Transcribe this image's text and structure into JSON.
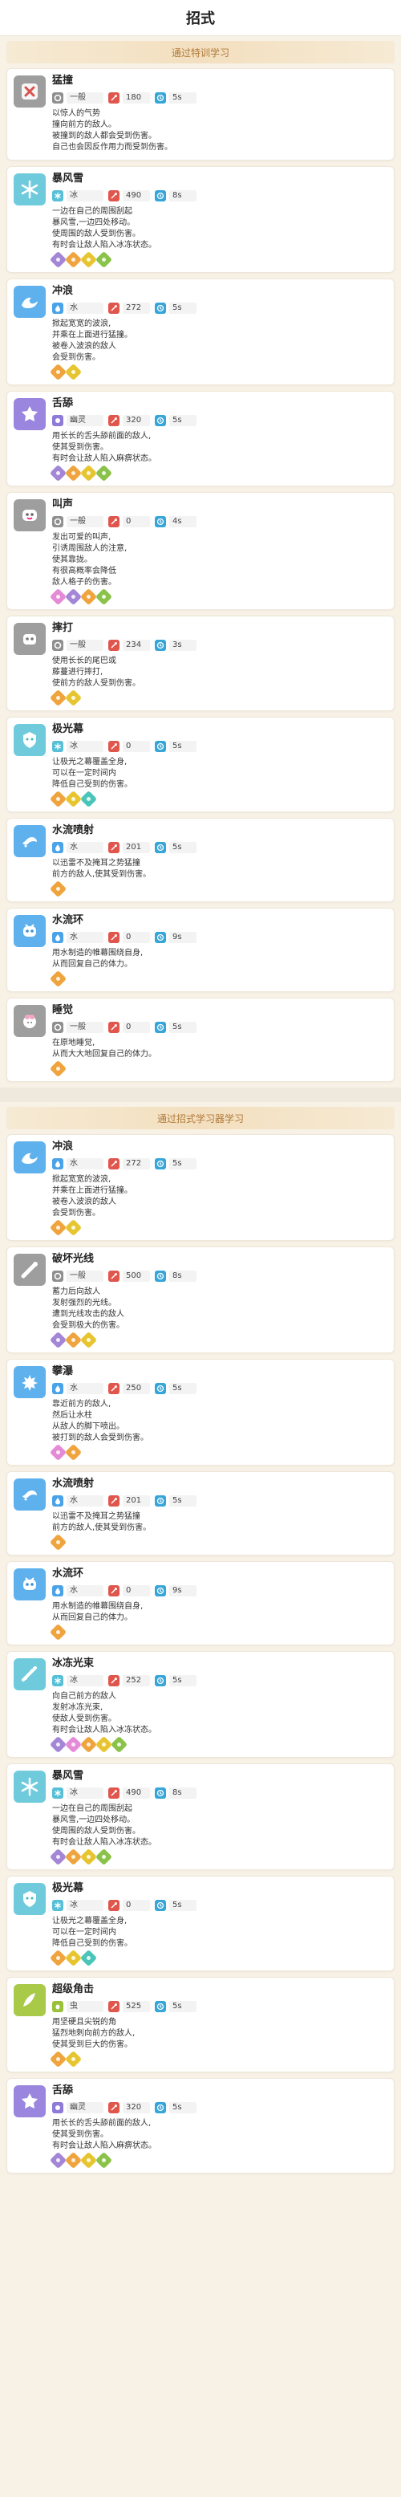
{
  "header": {
    "title": "招式"
  },
  "colors": {
    "type_gray": "#8f8f8f",
    "type_water": "#4aa3e8",
    "type_ice": "#57c0d6",
    "type_bug": "#9bc13a",
    "type_cute": "#8f7ad8",
    "power": "#e0554c",
    "cooldown": "#36a6d9"
  },
  "sections": [
    {
      "title": "通过特训学习",
      "moves": [
        {
          "name": "猛撞",
          "icon": "x-face-icon",
          "type": "一般",
          "typeKey": "gray",
          "power": "180",
          "cd": "5s",
          "desc": [
            "以惊人的气势",
            "撞向前方的敌人。",
            "被撞到的敌人都会受到伤害。",
            "自己也会因反作用力而受到伤害。"
          ],
          "tags": []
        },
        {
          "name": "暴风雪",
          "icon": "snowflake-icon",
          "type": "冰",
          "typeKey": "ice",
          "power": "490",
          "cd": "8s",
          "desc": [
            "一边在自己的周围刮起",
            "暴风雪,一边四处移动。",
            "使周围的敌人受到伤害。",
            "有时会让敌人陷入冰冻状态。"
          ],
          "tags": [
            "purple",
            "orange",
            "yellow",
            "green"
          ]
        },
        {
          "name": "冲浪",
          "icon": "wave-icon",
          "type": "水",
          "typeKey": "water",
          "power": "272",
          "cd": "5s",
          "desc": [
            "掀起宽宽的波浪,",
            "并乘在上面进行猛撞。",
            "被卷入波浪的敌人",
            "会受到伤害。"
          ],
          "tags": [
            "orange",
            "yellow"
          ]
        },
        {
          "name": "舌舔",
          "icon": "tongue-icon",
          "type": "幽灵",
          "typeKey": "cute",
          "power": "320",
          "cd": "5s",
          "desc": [
            "用长长的舌头舔前面的敌人,",
            "使其受到伤害。",
            "有时会让敌人陷入麻痹状态。"
          ],
          "tags": [
            "purple",
            "orange",
            "yellow",
            "green"
          ]
        },
        {
          "name": "叫声",
          "icon": "mouth-icon",
          "type": "一般",
          "typeKey": "gray",
          "power": "0",
          "cd": "4s",
          "desc": [
            "发出可爱的叫声,",
            "引诱周围敌人的注意,",
            "使其靠拢。",
            "有很高概率会降低",
            "敌人格子的伤害。"
          ],
          "tags": [
            "pink",
            "purple",
            "orange",
            "green"
          ]
        },
        {
          "name": "摔打",
          "icon": "fist-icon",
          "type": "一般",
          "typeKey": "gray",
          "power": "234",
          "cd": "3s",
          "desc": [
            "使用长长的尾巴或",
            "藤蔓进行摔打,",
            "使前方的敌人受到伤害。"
          ],
          "tags": [
            "orange",
            "yellow"
          ]
        },
        {
          "name": "极光幕",
          "icon": "aurora-icon",
          "type": "冰",
          "typeKey": "ice",
          "power": "0",
          "cd": "5s",
          "desc": [
            "让极光之幕覆盖全身,",
            "可以在一定时间内",
            "降低自己受到的伤害。"
          ],
          "tags": [
            "orange",
            "yellow",
            "teal"
          ]
        },
        {
          "name": "水流喷射",
          "icon": "water-jet-icon",
          "type": "水",
          "typeKey": "water",
          "power": "201",
          "cd": "5s",
          "desc": [
            "以迅雷不及掩耳之势猛撞",
            "前方的敌人,使其受到伤害。"
          ],
          "tags": [
            "orange"
          ]
        },
        {
          "name": "水流环",
          "icon": "water-ring-icon",
          "type": "水",
          "typeKey": "water",
          "power": "0",
          "cd": "9s",
          "desc": [
            "用水制造的帷幕围绕自身,",
            "从而回复自己的体力。"
          ],
          "tags": [
            "orange"
          ]
        },
        {
          "name": "睡觉",
          "icon": "sleep-icon",
          "type": "一般",
          "typeKey": "gray",
          "power": "0",
          "cd": "5s",
          "desc": [
            "在原地睡觉,",
            "从而大大地回复自己的体力。"
          ],
          "tags": [
            "orange"
          ]
        }
      ]
    },
    {
      "title": "通过招式学习器学习",
      "moves": [
        {
          "name": "冲浪",
          "icon": "wave-icon",
          "type": "水",
          "typeKey": "water",
          "power": "272",
          "cd": "5s",
          "desc": [
            "掀起宽宽的波浪,",
            "并乘在上面进行猛撞。",
            "被卷入波浪的敌人",
            "会受到伤害。"
          ],
          "tags": [
            "orange",
            "yellow"
          ]
        },
        {
          "name": "破坏光线",
          "icon": "beam-icon",
          "type": "一般",
          "typeKey": "gray",
          "power": "500",
          "cd": "8s",
          "desc": [
            "蓄力后向敌人",
            "发射强烈的光线。",
            "遭到光线攻击的敌人",
            "会受到极大的伤害。"
          ],
          "tags": [
            "purple",
            "orange",
            "yellow"
          ]
        },
        {
          "name": "攀瀑",
          "icon": "waterfall-icon",
          "type": "水",
          "typeKey": "water",
          "power": "250",
          "cd": "5s",
          "desc": [
            "靠近前方的敌人,",
            "然后让水柱",
            "从敌人的脚下喷出。",
            "被打到的敌人会受到伤害。"
          ],
          "tags": [
            "pink",
            "orange"
          ]
        },
        {
          "name": "水流喷射",
          "icon": "water-jet-icon",
          "type": "水",
          "typeKey": "water",
          "power": "201",
          "cd": "5s",
          "desc": [
            "以迅雷不及掩耳之势猛撞",
            "前方的敌人,使其受到伤害。"
          ],
          "tags": [
            "orange"
          ]
        },
        {
          "name": "水流环",
          "icon": "water-ring-icon",
          "type": "水",
          "typeKey": "water",
          "power": "0",
          "cd": "9s",
          "desc": [
            "用水制造的帷幕围绕自身,",
            "从而回复自己的体力。"
          ],
          "tags": [
            "orange"
          ]
        },
        {
          "name": "冰冻光束",
          "icon": "ice-beam-icon",
          "type": "冰",
          "typeKey": "ice",
          "power": "252",
          "cd": "5s",
          "desc": [
            "向自己前方的敌人",
            "发射冰冻光束,",
            "使敌人受到伤害。",
            "有时会让敌人陷入冰冻状态。"
          ],
          "tags": [
            "purple",
            "pink",
            "orange",
            "yellow",
            "green"
          ]
        },
        {
          "name": "暴风雪",
          "icon": "snowflake-icon",
          "type": "冰",
          "typeKey": "ice",
          "power": "490",
          "cd": "8s",
          "desc": [
            "一边在自己的周围刮起",
            "暴风雪,一边四处移动。",
            "使周围的敌人受到伤害。",
            "有时会让敌人陷入冰冻状态。"
          ],
          "tags": [
            "purple",
            "orange",
            "yellow",
            "green"
          ]
        },
        {
          "name": "极光幕",
          "icon": "aurora-icon",
          "type": "冰",
          "typeKey": "ice",
          "power": "0",
          "cd": "5s",
          "desc": [
            "让极光之幕覆盖全身,",
            "可以在一定时间内",
            "降低自己受到的伤害。"
          ],
          "tags": [
            "orange",
            "yellow",
            "teal"
          ]
        },
        {
          "name": "超级角击",
          "icon": "horn-icon",
          "type": "虫",
          "typeKey": "bug",
          "power": "525",
          "cd": "5s",
          "desc": [
            "用坚硬且尖锐的角",
            "猛烈地刺向前方的敌人,",
            "使其受到巨大的伤害。"
          ],
          "tags": [
            "orange",
            "yellow"
          ]
        },
        {
          "name": "舌舔",
          "icon": "tongue-icon",
          "type": "幽灵",
          "typeKey": "cute",
          "power": "320",
          "cd": "5s",
          "desc": [
            "用长长的舌头舔前面的敌人,",
            "使其受到伤害。",
            "有时会让敌人陷入麻痹状态。"
          ],
          "tags": [
            "purple",
            "orange",
            "yellow",
            "green"
          ]
        }
      ]
    }
  ]
}
